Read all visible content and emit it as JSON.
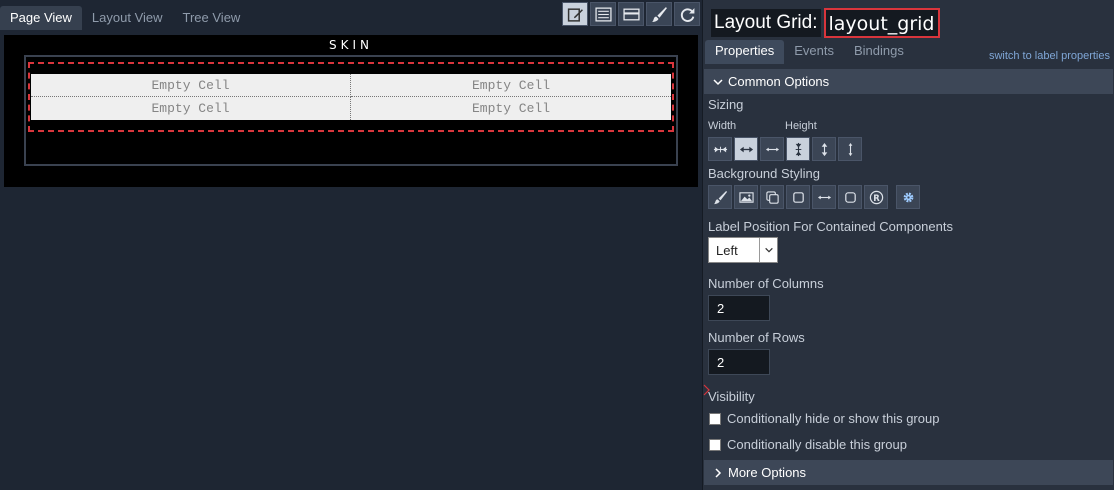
{
  "view_tabs": [
    "Page View",
    "Layout View",
    "Tree View"
  ],
  "active_view_tab": "Page View",
  "toolbar_icons": [
    "edit-icon",
    "list-icon",
    "card-icon",
    "brush-icon",
    "refresh-icon"
  ],
  "canvas": {
    "skin_label": "SKIN",
    "grid_cells": [
      "Empty Cell",
      "Empty Cell",
      "Empty Cell",
      "Empty Cell"
    ]
  },
  "properties": {
    "title_label": "Layout Grid:",
    "title_name": "layout_grid",
    "tabs": [
      "Properties",
      "Events",
      "Bindings"
    ],
    "switch_link": "switch to label properties",
    "common_options": "Common Options",
    "sizing_label": "Sizing",
    "width_label": "Width",
    "height_label": "Height",
    "background_styling_label": "Background Styling",
    "label_position_label": "Label Position For Contained Components",
    "label_position_value": "Left",
    "columns_label": "Number of Columns",
    "columns_value": "2",
    "rows_label": "Number of Rows",
    "rows_value": "2",
    "visibility_label": "Visibility",
    "checkbox_hide": "Conditionally hide or show this group",
    "checkbox_disable": "Conditionally disable this group",
    "more_options": "More Options"
  },
  "colors": {
    "selection_border": "#d9353c",
    "link": "#7fa6d6",
    "panel_bg": "#29313e",
    "canvas_bg": "#000000"
  }
}
